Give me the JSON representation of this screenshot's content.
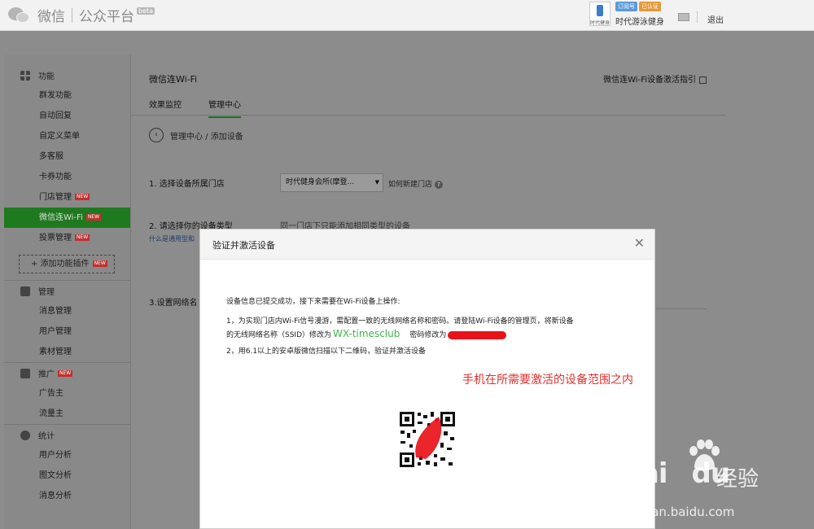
{
  "header": {
    "logo_text": "微信",
    "platform": "公众平台",
    "beta": "beta",
    "avatar_label": "时代健身",
    "badges": [
      "订阅号",
      "已认证"
    ],
    "user_name": "时代游泳健身",
    "logout": "退出"
  },
  "sidebar": {
    "groups": [
      {
        "title": "功能",
        "icon": "grid-icon",
        "items": [
          {
            "label": "群发功能",
            "new": false
          },
          {
            "label": "自动回复",
            "new": false
          },
          {
            "label": "自定义菜单",
            "new": false
          },
          {
            "label": "多客服",
            "new": false
          },
          {
            "label": "卡券功能",
            "new": false
          },
          {
            "label": "门店管理",
            "new": true
          },
          {
            "label": "微信连Wi-Fi",
            "new": true,
            "active": true
          },
          {
            "label": "投票管理",
            "new": true
          }
        ]
      },
      {
        "title": "管理",
        "icon": "inbox-icon",
        "items": [
          {
            "label": "消息管理"
          },
          {
            "label": "用户管理"
          },
          {
            "label": "素材管理"
          }
        ]
      },
      {
        "title": "推广",
        "icon": "megaphone-icon",
        "new": true,
        "items": [
          {
            "label": "广告主"
          },
          {
            "label": "流量主"
          }
        ]
      },
      {
        "title": "统计",
        "icon": "pie-chart-icon",
        "items": [
          {
            "label": "用户分析"
          },
          {
            "label": "图文分析"
          },
          {
            "label": "消息分析"
          }
        ]
      }
    ],
    "add_plugin": "添加功能插件",
    "new_tag": "NEW"
  },
  "main": {
    "title": "微信连Wi-Fi",
    "guide": "微信连Wi-Fi设备激活指引",
    "tabs": [
      "效果监控",
      "管理中心"
    ],
    "breadcrumb": "管理中心 / 添加设备",
    "step1_label": "1. 选择设备所属门店",
    "step1_select": "时代健身会所(摩登...",
    "step1_link": "如何新建门店",
    "step2_label": "2. 请选择你的设备类型",
    "step2_link": "什么是通用型和",
    "step2_note": "同一门店下只能添加相同类型的设备",
    "step3_label": "3.设置网络名"
  },
  "modal": {
    "title": "验证并激活设备",
    "intro": "设备信息已提交成功，接下来需要在Wi-Fi设备上操作:",
    "line1": "1，为实现门店内Wi-Fi信号漫游，需配置一致的无线网络名称和密码。请登陆Wi-Fi设备的管理页，将新设备",
    "line2_prefix": "的无线网络名称（SSID）修改为",
    "ssid": "WX-timesclub",
    "password_label": "密码修改为",
    "line3": "2，用6.1以上的安卓版微信扫描以下二维码，验证并激活设备"
  },
  "annotation": "手机在所需要激活的设备范围之内",
  "watermark": {
    "brand": "Bai",
    "brand2": "du",
    "cn": "经验",
    "url": "jingyan.baidu.com"
  },
  "colors": {
    "accent_green": "#44b549",
    "annotation_red": "#e3302c"
  }
}
